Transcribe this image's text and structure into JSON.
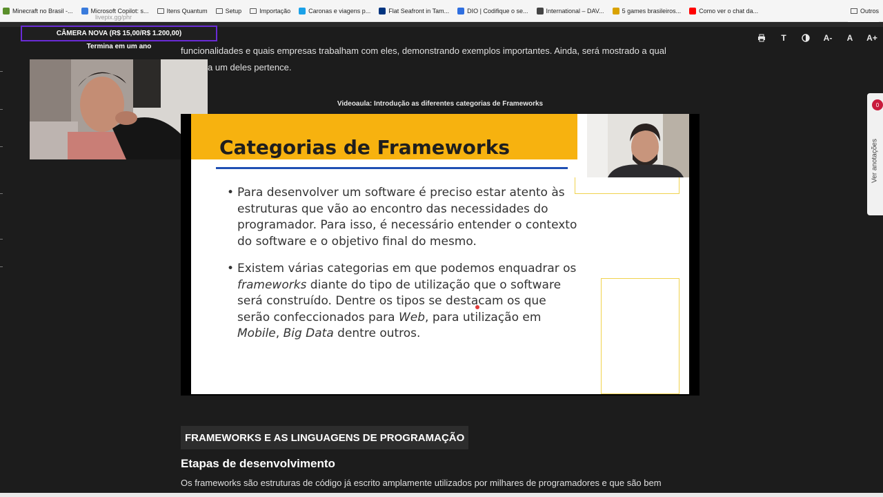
{
  "bookmarks": [
    {
      "label": "Minecraft no Brasil -...",
      "color": "#5a8f2b"
    },
    {
      "label": "Microsoft Copilot: s...",
      "color": "#3a7bdc"
    },
    {
      "label": "Itens Quantum",
      "folder": true
    },
    {
      "label": "Setup",
      "folder": true
    },
    {
      "label": "Importação",
      "folder": true
    },
    {
      "label": "Caronas e viagens p...",
      "color": "#1aa1e8"
    },
    {
      "label": "Flat Seafront in Tam...",
      "color": "#003580"
    },
    {
      "label": "DIO | Codifique o se...",
      "color": "#2f6fe0"
    },
    {
      "label": "International – DAV...",
      "color": "#444444"
    },
    {
      "label": "5 games brasileiros...",
      "color": "#d9a200"
    },
    {
      "label": "Como ver o chat da...",
      "color": "#ff0000"
    }
  ],
  "bookmarks_other": "Outros",
  "toolbar": {
    "print_icon": "printer-icon",
    "font_btn": "T",
    "contrast_icon": "contrast-icon",
    "decrease": "A-",
    "reset": "A",
    "increase": "A+"
  },
  "stream": {
    "camera_title": "CÂMERA NOVA (R$ 15,00/R$ 1.200,00)",
    "camera_sub": "Termina em um ano",
    "ghost_text": "livepix.gg/phr"
  },
  "article": {
    "para_top_line1": "funcionalidades e quais empresas trabalham com eles, demonstrando exemplos importantes. Ainda, será mostrado a qual",
    "para_top_line2": "ria cada um deles pertence.",
    "video_caption": "Videoaula: Introdução as diferentes categorias de Frameworks",
    "section_heading": "FRAMEWORKS E AS LINGUAGENS DE PROGRAMAÇÃO",
    "sub_heading": "Etapas de desenvolvimento",
    "para_bottom": "Os frameworks são estruturas de código já escrito amplamente utilizados por milhares de programadores e que são bem"
  },
  "slide": {
    "title": "Categorias de Frameworks",
    "bullet1": "Para desenvolver um software é preciso estar atento às estruturas que vão ao encontro das necessidades do programador. Para isso, é necessário entender o contexto do software e o objetivo final do mesmo.",
    "bullet2_a": "Existem várias categorias em que podemos enquadrar os ",
    "bullet2_b": "frameworks",
    "bullet2_c": " diante do tipo de utilização que o software será construído. Dentre os tipos se destacam os que serão confeccionados para ",
    "bullet2_d": "Web",
    "bullet2_e": ", para utilização em ",
    "bullet2_f": "Mobile",
    "bullet2_g": ", ",
    "bullet2_h": "Big Data",
    "bullet2_i": " dentre outros.",
    "bullet_glyph": "•"
  },
  "side_tab": {
    "label": "Ver anotações",
    "badge": "0"
  }
}
